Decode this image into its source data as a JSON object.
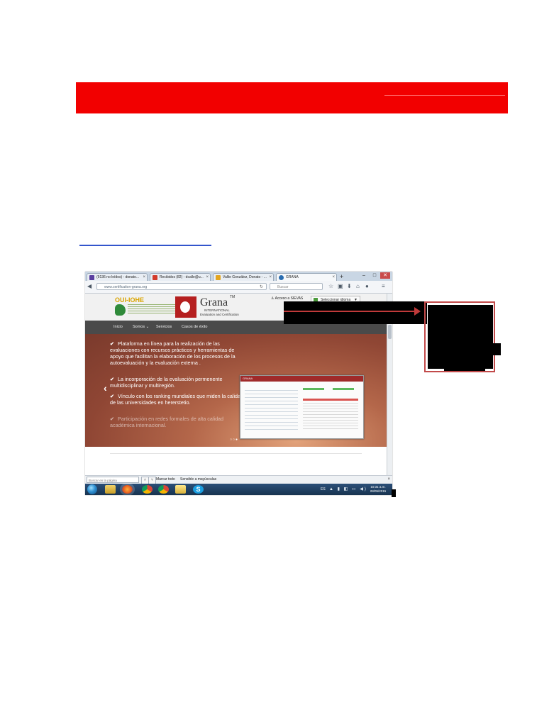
{
  "browser": {
    "tabs": [
      {
        "label": "(9136 no leídos) - donato...",
        "icon_color": "#5a3ea0",
        "active": false
      },
      {
        "label": "Recibidos (82) - dcalle@u...",
        "icon_color": "#d33b2c",
        "active": false
      },
      {
        "label": "Vallie González, Donato - ...",
        "icon_color": "#e3a51f",
        "active": false
      },
      {
        "label": "GRANA",
        "icon_color": "#2a6db0",
        "active": true
      }
    ],
    "new_tab_symbol": "+",
    "window_buttons": [
      "–",
      "□",
      "✕"
    ],
    "url": "www.certification-grana.org",
    "search_placeholder": "Buscar",
    "find_bar": {
      "placeholder": "Buscar en la página",
      "mark_all": "Marcar todo",
      "match_case": "Sensible a mayúsculas"
    }
  },
  "site": {
    "oui_logo": "OUI-IOHE",
    "brand_name": "Grana",
    "brand_tm": "TM",
    "brand_international": "INTERNATIONAL",
    "brand_tagline": "Evaluation and Certification",
    "sievas_link": "Acceso a SIEVAS",
    "language_select": "Seleccionar idioma",
    "nav": [
      "Inicio",
      "Somos",
      "Servicios",
      "Casos de éxito"
    ],
    "hero_bullets": [
      "Plataforma en línea para la realización de las evaluaciones con recursos prácticos y herramientas de apoyo que facilitan la elaboración de los procesos de la autoevaluación y la evaluación externa .",
      "La incorporación de la evaluación permenente multidisciplinar y multiregión.",
      "Vínculo con los ranking mundiales que miden la calidad de las universidades en hererstetio.",
      "Participación en redes formales de alta calidad académica internacional."
    ],
    "slide_dots": "○○●",
    "slide_title": "GRANA"
  },
  "taskbar": {
    "language": "ES",
    "time": "10:31 a.m.",
    "date": "28/05/2015"
  },
  "colors": {
    "banner_red": "#f20000",
    "annotation_red": "#c03a3a",
    "nav_dark": "#4a4a4a",
    "hero_brown": "#8f4634"
  }
}
